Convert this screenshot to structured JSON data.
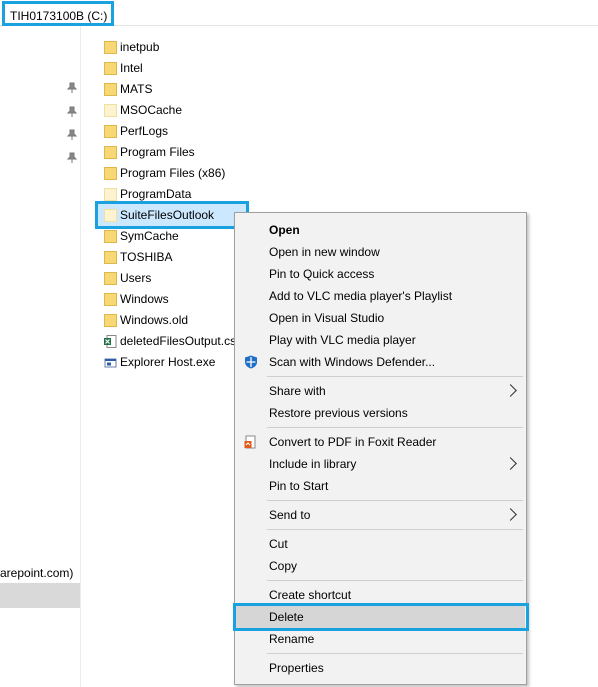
{
  "address": {
    "drive_label": "TIH0173100B (C:)"
  },
  "nav": {
    "partial_text": "arepoint.com)"
  },
  "files": [
    {
      "name": "inetpub",
      "type": "folder"
    },
    {
      "name": "Intel",
      "type": "folder"
    },
    {
      "name": "MATS",
      "type": "folder"
    },
    {
      "name": "MSOCache",
      "type": "folder-faint"
    },
    {
      "name": "PerfLogs",
      "type": "folder"
    },
    {
      "name": "Program Files",
      "type": "folder"
    },
    {
      "name": "Program Files (x86)",
      "type": "folder"
    },
    {
      "name": "ProgramData",
      "type": "folder-faint"
    },
    {
      "name": "SuiteFilesOutlook",
      "type": "folder-faint"
    },
    {
      "name": "SymCache",
      "type": "folder"
    },
    {
      "name": "TOSHIBA",
      "type": "folder"
    },
    {
      "name": "Users",
      "type": "folder"
    },
    {
      "name": "Windows",
      "type": "folder"
    },
    {
      "name": "Windows.old",
      "type": "folder"
    },
    {
      "name": "deletedFilesOutput.cs",
      "type": "excel-file"
    },
    {
      "name": "Explorer Host.exe",
      "type": "exe-file"
    }
  ],
  "context_menu": {
    "open": "Open",
    "open_new_window": "Open in new window",
    "pin_quick_access": "Pin to Quick access",
    "add_vlc_playlist": "Add to VLC media player's Playlist",
    "open_visual_studio": "Open in Visual Studio",
    "play_vlc": "Play with VLC media player",
    "scan_defender": "Scan with Windows Defender...",
    "share_with": "Share with",
    "restore_versions": "Restore previous versions",
    "convert_pdf": "Convert to PDF in Foxit Reader",
    "include_library": "Include in library",
    "pin_start": "Pin to Start",
    "send_to": "Send to",
    "cut": "Cut",
    "copy": "Copy",
    "create_shortcut": "Create shortcut",
    "delete": "Delete",
    "rename": "Rename",
    "properties": "Properties"
  },
  "colors": {
    "highlight": "#1aa1e0",
    "selection": "#cce8ff",
    "folder": "#f8d775"
  }
}
